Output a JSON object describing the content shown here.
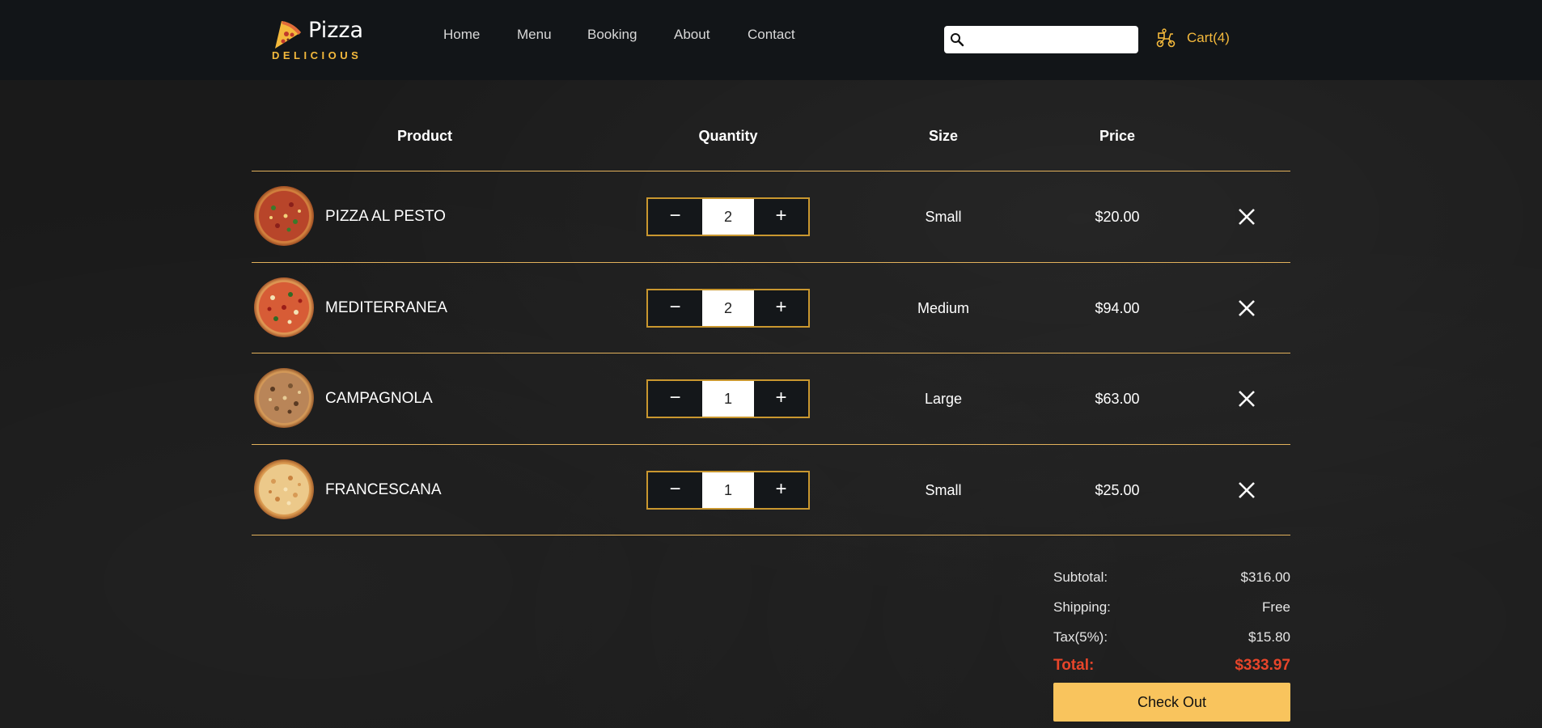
{
  "brand": {
    "name": "Pizza",
    "tagline": "DELICIOUS",
    "accent": "#f4b93c"
  },
  "nav": {
    "items": [
      "Home",
      "Menu",
      "Booking",
      "About",
      "Contact"
    ]
  },
  "search": {
    "value": "",
    "placeholder": "",
    "icon": "search-icon"
  },
  "cart": {
    "label": "Cart(4)",
    "icon": "scooter-icon"
  },
  "table": {
    "headers": {
      "product": "Product",
      "quantity": "Quantity",
      "size": "Size",
      "price": "Price"
    },
    "rows": [
      {
        "name": "PIZZA AL PESTO",
        "qty": "2",
        "size": "Small",
        "price": "$20.00"
      },
      {
        "name": "MEDITERRANEA",
        "qty": "2",
        "size": "Medium",
        "price": "$94.00"
      },
      {
        "name": "CAMPAGNOLA",
        "qty": "1",
        "size": "Large",
        "price": "$63.00"
      },
      {
        "name": "FRANCESCANA",
        "qty": "1",
        "size": "Small",
        "price": "$25.00"
      }
    ],
    "minus": "−",
    "plus": "+"
  },
  "summary": {
    "subtotal_label": "Subtotal:",
    "subtotal": "$316.00",
    "shipping_label": "Shipping:",
    "shipping": "Free",
    "tax_label": "Tax(5%):",
    "tax": "$15.80",
    "total_label": "Total:",
    "total": "$333.97",
    "total_color": "#e8452a"
  },
  "checkout_label": "Check Out",
  "colors": {
    "header_bg": "#121518",
    "divider": "#e2b15b",
    "qty_border": "#c9972f",
    "checkout_bg": "#f9c45d"
  }
}
